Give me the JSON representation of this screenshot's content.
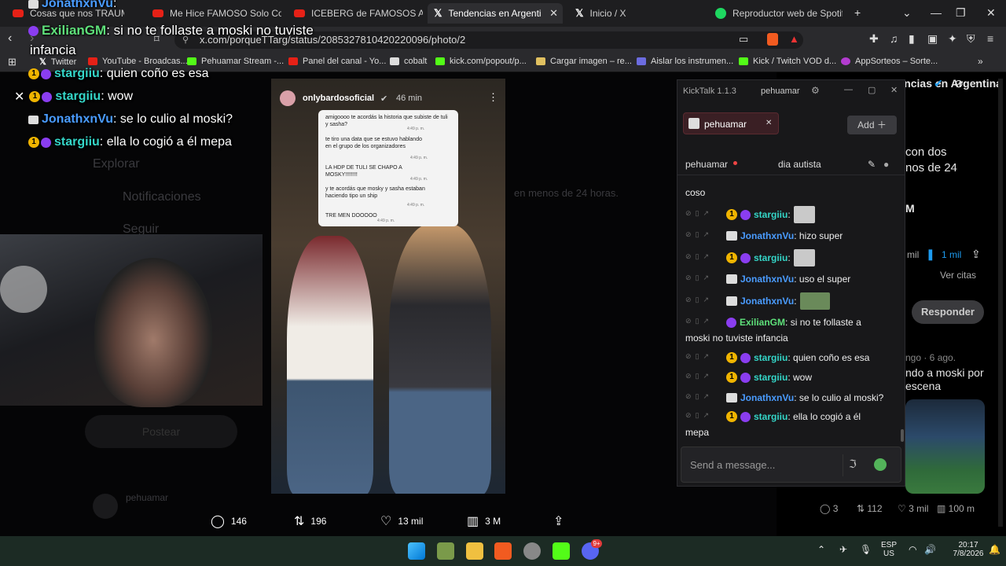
{
  "browser": {
    "tabs": [
      {
        "label": "Cosas que nos TRAUMARON",
        "icon": "youtube-icon"
      },
      {
        "label": "Me Hice FAMOSO Solo Con ME",
        "icon": "youtube-icon"
      },
      {
        "label": "ICEBERG de FAMOSOS ARGENT",
        "icon": "youtube-icon"
      },
      {
        "label": "Tendencias en Argentina / X",
        "icon": "x-icon",
        "active": true
      },
      {
        "label": "Inicio / X",
        "icon": "x-icon"
      },
      {
        "label": "Reproductor web de Spotify: m",
        "icon": "spotify-icon"
      }
    ],
    "new_tab": "+",
    "url": "x.com/porqueTTarg/status/2085327810420220096/photo/2",
    "bookmarks": [
      "Twitter",
      "YouTube - Broadcas...",
      "Pehuamar Stream -...",
      "Panel del canal - Yo...",
      "cobalt",
      "kick.com/popout/p...",
      "Cargar imagen – re...",
      "Aislar los instrumen...",
      "Kick / Twitch VOD d...",
      "AppSorteos – Sorte..."
    ]
  },
  "overlay_chat": [
    {
      "user": "JonathxnVu",
      "text": ""
    },
    {
      "user": "ExilianGM",
      "text": "si no te follaste a moski no tuviste"
    },
    {
      "user": "",
      "text": "infancia"
    },
    {
      "user": "stargiiu",
      "text": "quien coño es esa"
    },
    {
      "user": "stargiiu",
      "text": "wow"
    },
    {
      "user": "JonathxnVu",
      "text": "se lo culio al moski?"
    },
    {
      "user": "stargiiu",
      "text": "ella lo cogió a él mepa"
    }
  ],
  "x_page": {
    "ghost_nav": [
      "Explorar",
      "Notificaciones",
      "Seguir"
    ],
    "post_button": "Postear",
    "ghost_user": "pehuamar",
    "ghost_text": "en menos de 24 horas.",
    "post": {
      "author": "onlybardosoficial",
      "time": "46 min",
      "card_lines": [
        "amigoooo te acordás la historia que subiste de tuli y sasha?",
        "te tiro una data que se estuvo hablando en el grupo de los organizadores",
        "LA HDP DE TULI SE CHAPO A MOSKY!!!!!!!!",
        "y te acordás que mosky y sasha estaban haciendo tipo un ship",
        "TRE MEN DOOOOO"
      ],
      "card_time": "4:49 p. m."
    },
    "actions": {
      "replies": "146",
      "reposts": "196",
      "likes": "13 mil",
      "views": "3 M"
    },
    "right_panel": {
      "title": "Tendencias en Argentina",
      "line1": "con dos",
      "line2": "nos de 24",
      "letter_m": "M",
      "stats_left": "mil",
      "bookmarks": "1 mil",
      "ver_citas": "Ver citas",
      "reply_button": "Responder",
      "reply_meta": "ngo · 6 ago.",
      "reply_line1": "ndo a moski por",
      "reply_line2": "escena",
      "bottom_stats": {
        "replies": "3",
        "reposts": "112",
        "likes": "3 mil",
        "views": "100 m"
      }
    }
  },
  "kicktalk": {
    "title": "KickTalk 1.1.3",
    "user": "pehuamar",
    "chip": "pehuamar",
    "add_label": "Add",
    "channel": "pehuamar",
    "stream_title": "dia autista",
    "messages": [
      {
        "user": "",
        "text": "coso"
      },
      {
        "user": "stargiiu",
        "text": "",
        "emote": true
      },
      {
        "user": "JonathxnVu",
        "text": "hizo super"
      },
      {
        "user": "stargiiu",
        "text": "",
        "emote": true
      },
      {
        "user": "JonathxnVu",
        "text": "uso el super"
      },
      {
        "user": "JonathxnVu",
        "text": "",
        "emote": true
      },
      {
        "user": "ExilianGM",
        "text": "si no te follaste a"
      },
      {
        "user": "",
        "text": "moski no tuviste infancia"
      },
      {
        "user": "stargiiu",
        "text": "quien coño es esa"
      },
      {
        "user": "stargiiu",
        "text": "wow"
      },
      {
        "user": "JonathxnVu",
        "text": "se lo culio al moski?"
      },
      {
        "user": "stargiiu",
        "text": "ella lo cogió a él"
      },
      {
        "user": "",
        "text": "mepa"
      }
    ],
    "input_placeholder": "Send a message..."
  },
  "taskbar": {
    "lang": "ESP",
    "region": "US",
    "time": "20:17",
    "date": "7/8/2026",
    "badge": "9+"
  }
}
